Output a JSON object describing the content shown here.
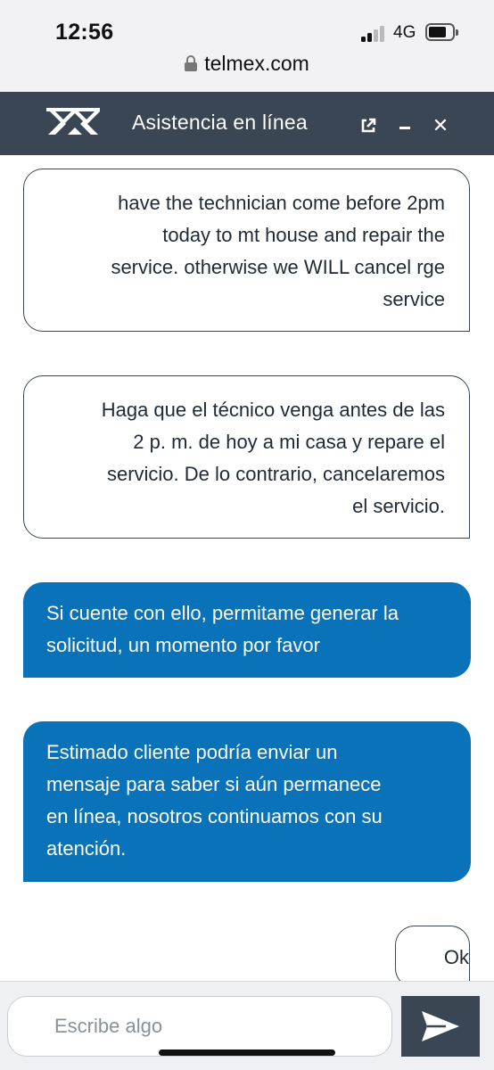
{
  "status_bar": {
    "time": "12:56",
    "network": "4G",
    "url": "telmex.com"
  },
  "header": {
    "title": "Asistencia en línea",
    "logo": "telmex-logo",
    "icons": [
      "popout-icon",
      "minimize-icon",
      "close-icon"
    ],
    "close_label": "✕"
  },
  "messages": [
    {
      "sender": "user",
      "lines": [
        "have the technician come before 2pm",
        "today to mt house and repair the",
        "service. otherwise we WILL cancel rge",
        "service"
      ]
    },
    {
      "sender": "user",
      "lines": [
        "Haga que el técnico venga antes de las",
        "2 p. m. de hoy a mi casa y repare el",
        "servicio. De lo contrario, cancelaremos",
        "el servicio."
      ]
    },
    {
      "sender": "agent",
      "lines": [
        "Si cuente con ello, permitame generar la",
        "solicitud, un momento por favor"
      ]
    },
    {
      "sender": "agent",
      "lines": [
        "Estimado cliente podría enviar un",
        "mensaje para saber si aún permanece",
        "en línea, nosotros continuamos con su",
        "atención."
      ]
    },
    {
      "sender": "user",
      "lines": [
        "Ok"
      ]
    }
  ],
  "composer": {
    "placeholder": "Escribe algo",
    "send_icon": "send-icon"
  },
  "colors": {
    "header_bg": "#3a4654",
    "agent_bubble": "#0a72b9",
    "user_bubble_border": "#3a4654"
  }
}
